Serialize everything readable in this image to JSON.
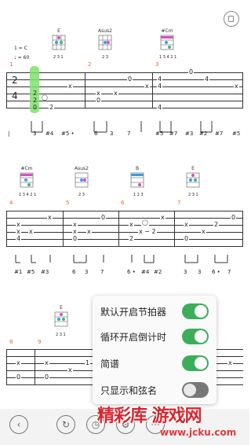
{
  "header": {
    "key": "1 = C",
    "tempo": "♩ = 60"
  },
  "rows": [
    {
      "chords": [
        "E",
        "Asus2",
        "#Cm"
      ],
      "fingers": [
        "2 3 1",
        "2 3",
        "1 3 4 2 1"
      ],
      "measures": [
        "1",
        "2",
        "3"
      ],
      "tab_left": [
        "2",
        "4"
      ],
      "jianpu": [
        "|",
        "3",
        "#4",
        "#5 •",
        "6",
        "3",
        "7",
        "#5",
        "#7",
        "#3",
        "#2",
        "#7",
        "#5"
      ]
    },
    {
      "chords": [
        "#Cm",
        "Asus2",
        "B",
        "E"
      ],
      "fingers": [
        "1 3 4 2 1",
        "2 3",
        "1 2 3",
        "2 3 1"
      ],
      "measures": [
        "4",
        "5",
        "6",
        "7"
      ],
      "jianpu": [
        "#1",
        "#5",
        "#3",
        "6",
        "3",
        "7",
        "6 •",
        "#4",
        "#2",
        "3",
        "3",
        "6 •",
        "7"
      ]
    },
    {
      "chords": [
        "E"
      ],
      "fingers": [
        "2 3 1"
      ],
      "measures": [
        "8",
        "9"
      ]
    }
  ],
  "settings_popup": {
    "items": [
      {
        "label": "默认开启节拍器",
        "on": true
      },
      {
        "label": "循环开启倒计时",
        "on": true
      },
      {
        "label": "简谱",
        "on": true
      },
      {
        "label": "只显示和弦名",
        "on": false
      }
    ],
    "colors": {
      "on": "#3cae5a",
      "off": "#777777"
    }
  },
  "bottom_bar": {
    "buttons": [
      "back-icon",
      "loop-icon",
      "speed-icon",
      "settings-icon",
      "more-icon"
    ]
  },
  "watermark": {
    "title": "精彩库 游戏网",
    "url": "www.jcku.com"
  },
  "accent": "#7ee36a"
}
